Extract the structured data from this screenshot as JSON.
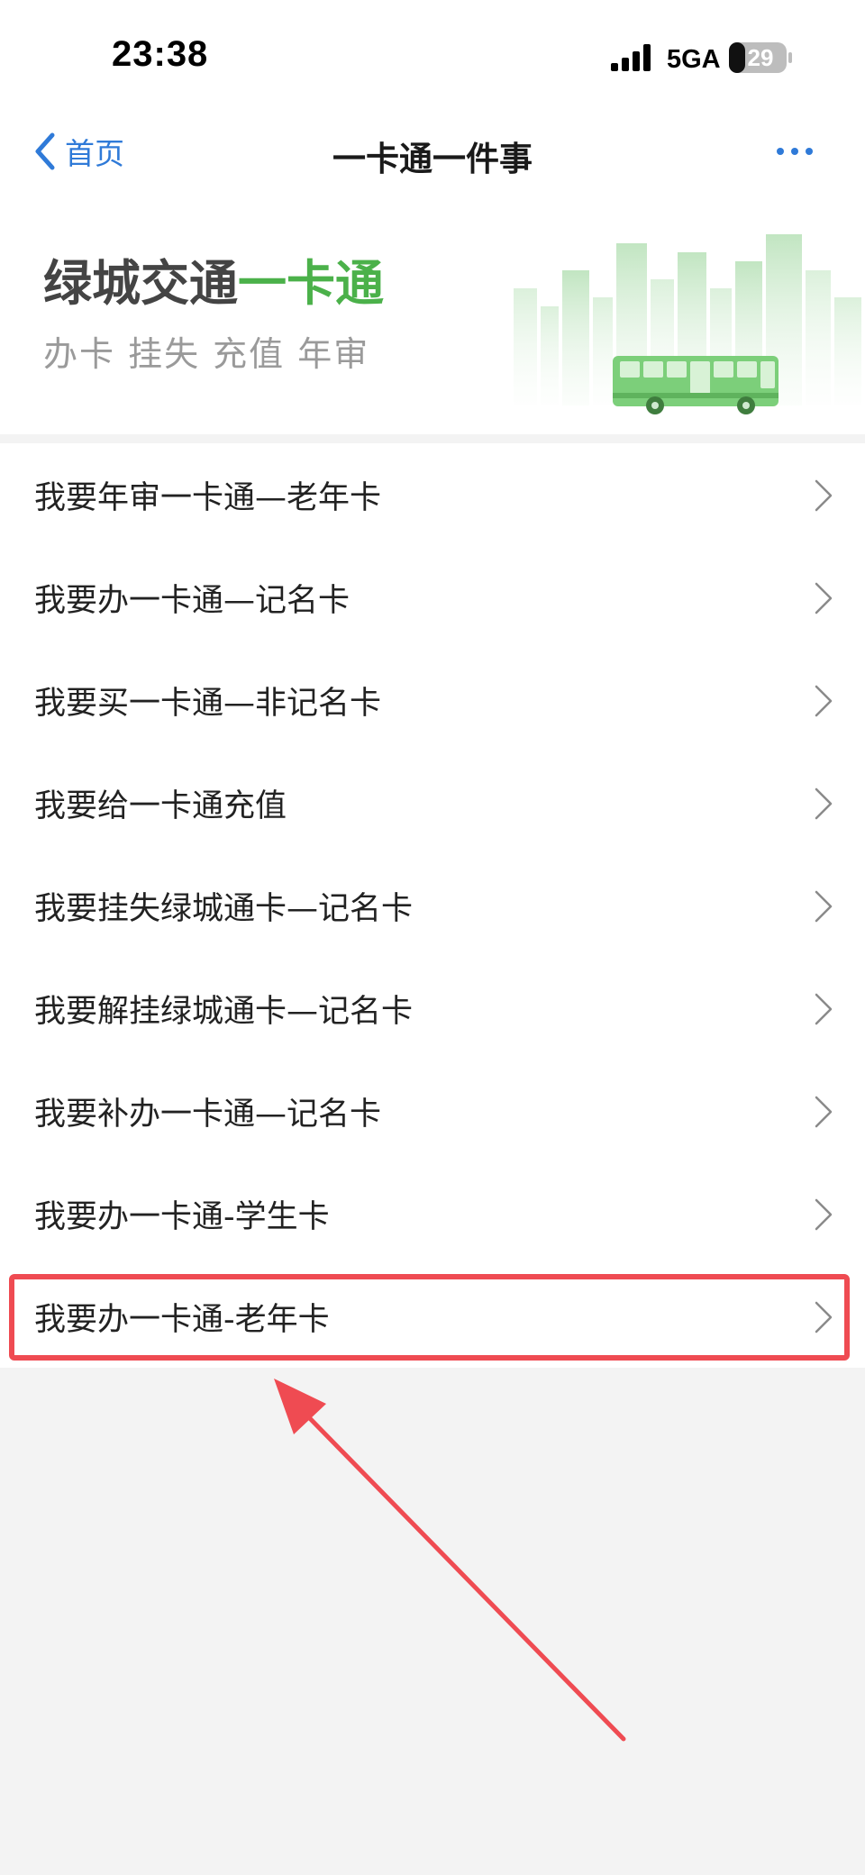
{
  "status_bar": {
    "time": "23:38",
    "network": "5GA",
    "battery": "29"
  },
  "nav": {
    "back_label": "首页",
    "title": "一卡通一件事",
    "more_icon": "more-dots-icon"
  },
  "banner": {
    "title_main": "绿城交通",
    "title_accent": "一卡通",
    "subtitle": "办卡 挂失 充值 年审",
    "illustration": "city-bus-illustration"
  },
  "services": [
    {
      "label": "我要年审一卡通—老年卡"
    },
    {
      "label": "我要办一卡通—记名卡"
    },
    {
      "label": "我要买一卡通—非记名卡"
    },
    {
      "label": "我要给一卡通充值"
    },
    {
      "label": "我要挂失绿城通卡—记名卡"
    },
    {
      "label": "我要解挂绿城通卡—记名卡"
    },
    {
      "label": "我要补办一卡通—记名卡"
    },
    {
      "label": "我要办一卡通-学生卡"
    },
    {
      "label": "我要办一卡通-老年卡"
    }
  ],
  "colors": {
    "accent_blue": "#2f7ad8",
    "brand_green": "#4bb14a",
    "highlight_red": "#ef4b52",
    "background": "#f3f3f3"
  }
}
